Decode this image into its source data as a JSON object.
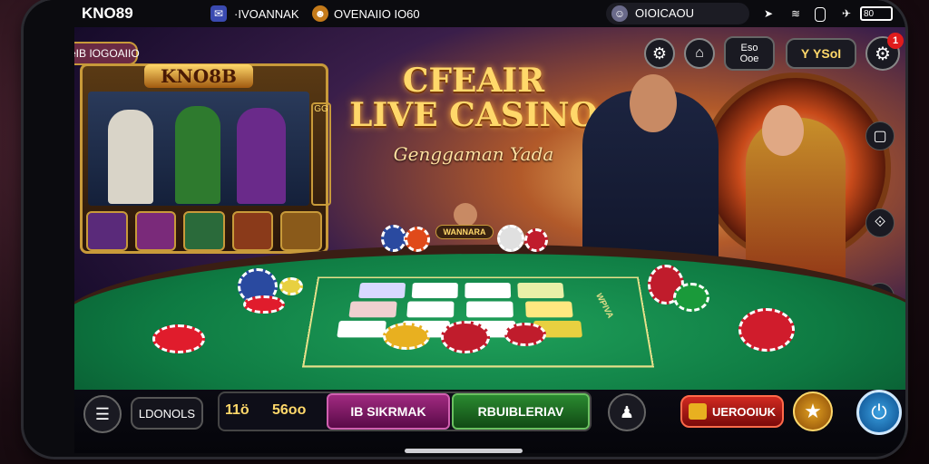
{
  "statusbar": {
    "app_title": "KNO89",
    "badge_text": "·IVOANNAK",
    "channel_text": "OVENAIIO IO60",
    "search_text": "OIOICAOU",
    "battery_text": "80"
  },
  "header": {
    "brand_pill": "CeIB IOGOAIIO",
    "tile1": "Eso\nOoe",
    "balance_pill": "Y YSoI",
    "notif_count": "1"
  },
  "promo_card": {
    "title": "KNO8B",
    "frame_label": "GG"
  },
  "hero": {
    "line1": "CFEAIR",
    "line2": "LIVE CASINO",
    "subtitle": "Genggaman Yada",
    "dealer_badge": "WANNARA"
  },
  "table": {
    "side_label": "WPIVA"
  },
  "bottombar": {
    "lobby_label": "LDONOLS",
    "score_left": "11ö",
    "score_right": "56oo",
    "tab_pink": "IB SIKRMAK",
    "tab_green": "RBUIBLERIAV",
    "store_label": "UEROOIUK"
  },
  "icons": {
    "menu": "menu-icon",
    "settings": "gear-icon",
    "profile": "profile-icon",
    "star": "star-icon",
    "power": "power-icon"
  },
  "colors": {
    "felt": "#0e7a42",
    "accent_gold": "#ffd86a",
    "pink_tab": "#8a1c6a",
    "green_tab": "#1f6a24",
    "red_btn": "#b01c1c"
  }
}
